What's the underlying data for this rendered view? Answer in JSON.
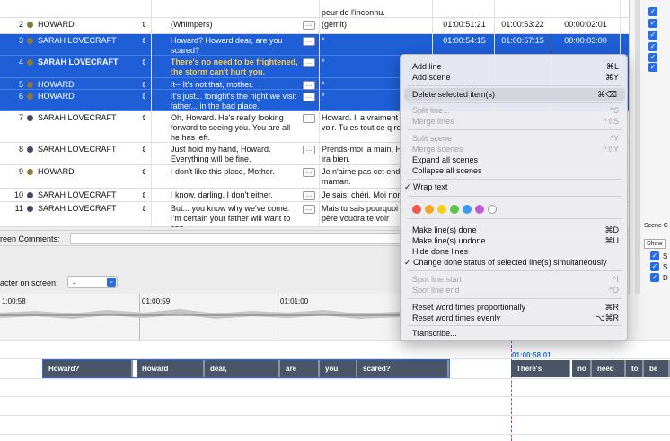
{
  "table": {
    "top_row": {
      "translation": "peur de l'inconnu."
    },
    "rows": [
      {
        "num": "2",
        "name": "HOWARD",
        "dot": "#8a7a3a",
        "text": "(Whimpers)",
        "trans": "(gémit)",
        "tin": "01:00:51:21",
        "tout": "01:00:53:22",
        "dur": "00:00:02:01",
        "sel": false
      },
      {
        "num": "3",
        "name": "SARAH LOVECRAFT",
        "dot": "#8a7a3a",
        "text": "Howard? Howard dear, are you scared?",
        "trans": "*",
        "tin": "01:00:54:15",
        "tout": "01:00:57:15",
        "dur": "00:00:03:00",
        "sel": true
      },
      {
        "num": "4",
        "name": "SARAH LOVECRAFT",
        "dot": "#8a7a3a",
        "text": "There's no need to be frightened, the storm can't hurt you.",
        "trans": "*",
        "tin": "",
        "tout": "",
        "dur": "",
        "sel": true,
        "bold": true
      },
      {
        "num": "5",
        "name": "HOWARD",
        "dot": "#8a7a3a",
        "text": "It-- It's not that, mother.",
        "trans": "*",
        "tin": "",
        "tout": "",
        "dur": "",
        "sel": true
      },
      {
        "num": "6",
        "name": "HOWARD",
        "dot": "#8a7a3a",
        "text": "It's just... tonight's the night we visit father... in the bad place.",
        "trans": "*",
        "tin": "",
        "tout": "",
        "dur": "",
        "sel": true
      },
      {
        "num": "7",
        "name": "SARAH LOVECRAFT",
        "dot": "#3b4a6b",
        "text": "Oh, Howard. He's really looking forward to seeing you. You are all he has left.",
        "trans": "Howard. Il a vraiment h te voir. Tu es tout ce q reste.",
        "tin": "",
        "tout": "",
        "dur": "",
        "sel": false
      },
      {
        "num": "8",
        "name": "SARAH LOVECRAFT",
        "dot": "#3b4a6b",
        "text": "Just hold my hand, Howard. Everything will be fine.",
        "trans": "Prends-moi la main, Ho Tout ira bien.",
        "tin": "",
        "tout": "",
        "dur": "",
        "sel": false
      },
      {
        "num": "9",
        "name": "HOWARD",
        "dot": "#8a7a3a",
        "text": "I don't like this place, Mother.",
        "trans": "Je n'aime pas cet endroit, maman.",
        "tin": "",
        "tout": "",
        "dur": "",
        "sel": false
      },
      {
        "num": "10",
        "name": "SARAH LOVECRAFT",
        "dot": "#3b4a6b",
        "text": "I know, darling. I don't either.",
        "trans": "Je sais, chéri. Moi non",
        "tin": "",
        "tout": "",
        "dur": "",
        "sel": false
      },
      {
        "num": "11",
        "name": "SARAH LOVECRAFT",
        "dot": "#3b4a6b",
        "text": "But... you know why we've come. I'm certain your father will want to see",
        "trans": "Mais tu sais pourquoi o Ton père voudra te voir",
        "tin": "",
        "tout": "",
        "dur": "",
        "sel": false
      }
    ]
  },
  "comments": {
    "label": "reen Comments:"
  },
  "character": {
    "label": "acter on screen:",
    "value": "-"
  },
  "right_panel": {
    "scene_label": "Scene C",
    "show_label": "Show",
    "items": [
      "S",
      "S",
      "D"
    ]
  },
  "timeline": {
    "t1": "1:00:58",
    "t2": "01:00:59",
    "t3": "01:01:00",
    "cursor_time": "01:00:58:01",
    "words": [
      "Howard?",
      "Howard",
      "dear,",
      "are",
      "you",
      "scared?",
      "There's",
      "no",
      "need",
      "to",
      "be"
    ]
  },
  "menu": {
    "add_line": "Add line",
    "add_line_k": "⌘L",
    "add_scene": "Add scene",
    "add_scene_k": "⌘Y",
    "delete": "Delete selected item(s)",
    "delete_k": "⌘⌫",
    "split_line": "Split line...",
    "split_line_k": "^S",
    "merge_lines": "Merge lines",
    "merge_lines_k": "^⇧S",
    "split_scene": "Split scene",
    "split_scene_k": "^Y",
    "merge_scenes": "Merge scenes",
    "merge_scenes_k": "^⇧Y",
    "expand": "Expand all scenes",
    "collapse": "Collapse all scenes",
    "wrap": "✓ Wrap text",
    "colors": [
      "#f0574f",
      "#f5a623",
      "#f7d01c",
      "#5bc44b",
      "#3a9bf0",
      "#c25ad6"
    ],
    "done": "Make line(s) done",
    "done_k": "⌘D",
    "undone": "Make line(s) undone",
    "undone_k": "⌘U",
    "hide_done": "Hide done lines",
    "change_done": "✓ Change done status of selected line(s) simultaneously",
    "spot_start": "Spot line start",
    "spot_start_k": "^I",
    "spot_end": "Spot line end",
    "spot_end_k": "^O",
    "reset_prop": "Reset word times proportionally",
    "reset_prop_k": "⌘R",
    "reset_even": "Reset word times evenly",
    "reset_even_k": "⌥⌘R",
    "transcribe": "Transcribe..."
  }
}
